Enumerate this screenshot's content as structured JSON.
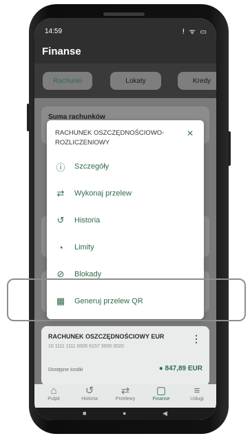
{
  "status": {
    "time": "14:59",
    "icons": "ⵑ ᯤ ▭"
  },
  "header": {
    "title": "Finanse"
  },
  "tabs": [
    "Rachunki",
    "Lokaty",
    "Kredy"
  ],
  "background_card": {
    "label": "Suma rachunków"
  },
  "modal": {
    "title": "RACHUNEK OSZCZĘDNOŚCIOWO-ROZLICZENIOWY",
    "close_icon": "×",
    "items": [
      {
        "label": "Szczegóły",
        "icon": "ⓘ"
      },
      {
        "label": "Wykonaj przelew",
        "icon": "⇄"
      },
      {
        "label": "Historia",
        "icon": "↺"
      },
      {
        "label": "Limity",
        "icon": "◔"
      },
      {
        "label": "Blokady",
        "icon": "⊘"
      },
      {
        "label": "Generuj przelew QR",
        "icon": "▦"
      }
    ]
  },
  "account": {
    "name": "RACHUNEK OSZCZĘDNOŚCIOWY EUR",
    "number": "10 1111 1111 0005 6157 3000 0020",
    "available_label": "Dostępne środki",
    "balance": "● 847,89 EUR",
    "menu": "⋮"
  },
  "bottom_nav": [
    {
      "label": "Pulpit",
      "icon": "⌂",
      "active": false
    },
    {
      "label": "Historia",
      "icon": "↺",
      "active": false
    },
    {
      "label": "Przelewy",
      "icon": "⇄",
      "active": false
    },
    {
      "label": "Finanse",
      "icon": "▢",
      "active": true
    },
    {
      "label": "Usługi",
      "icon": "≡",
      "active": false
    }
  ],
  "system_nav": {
    "recents": "■",
    "home": "●",
    "back": "◀"
  }
}
